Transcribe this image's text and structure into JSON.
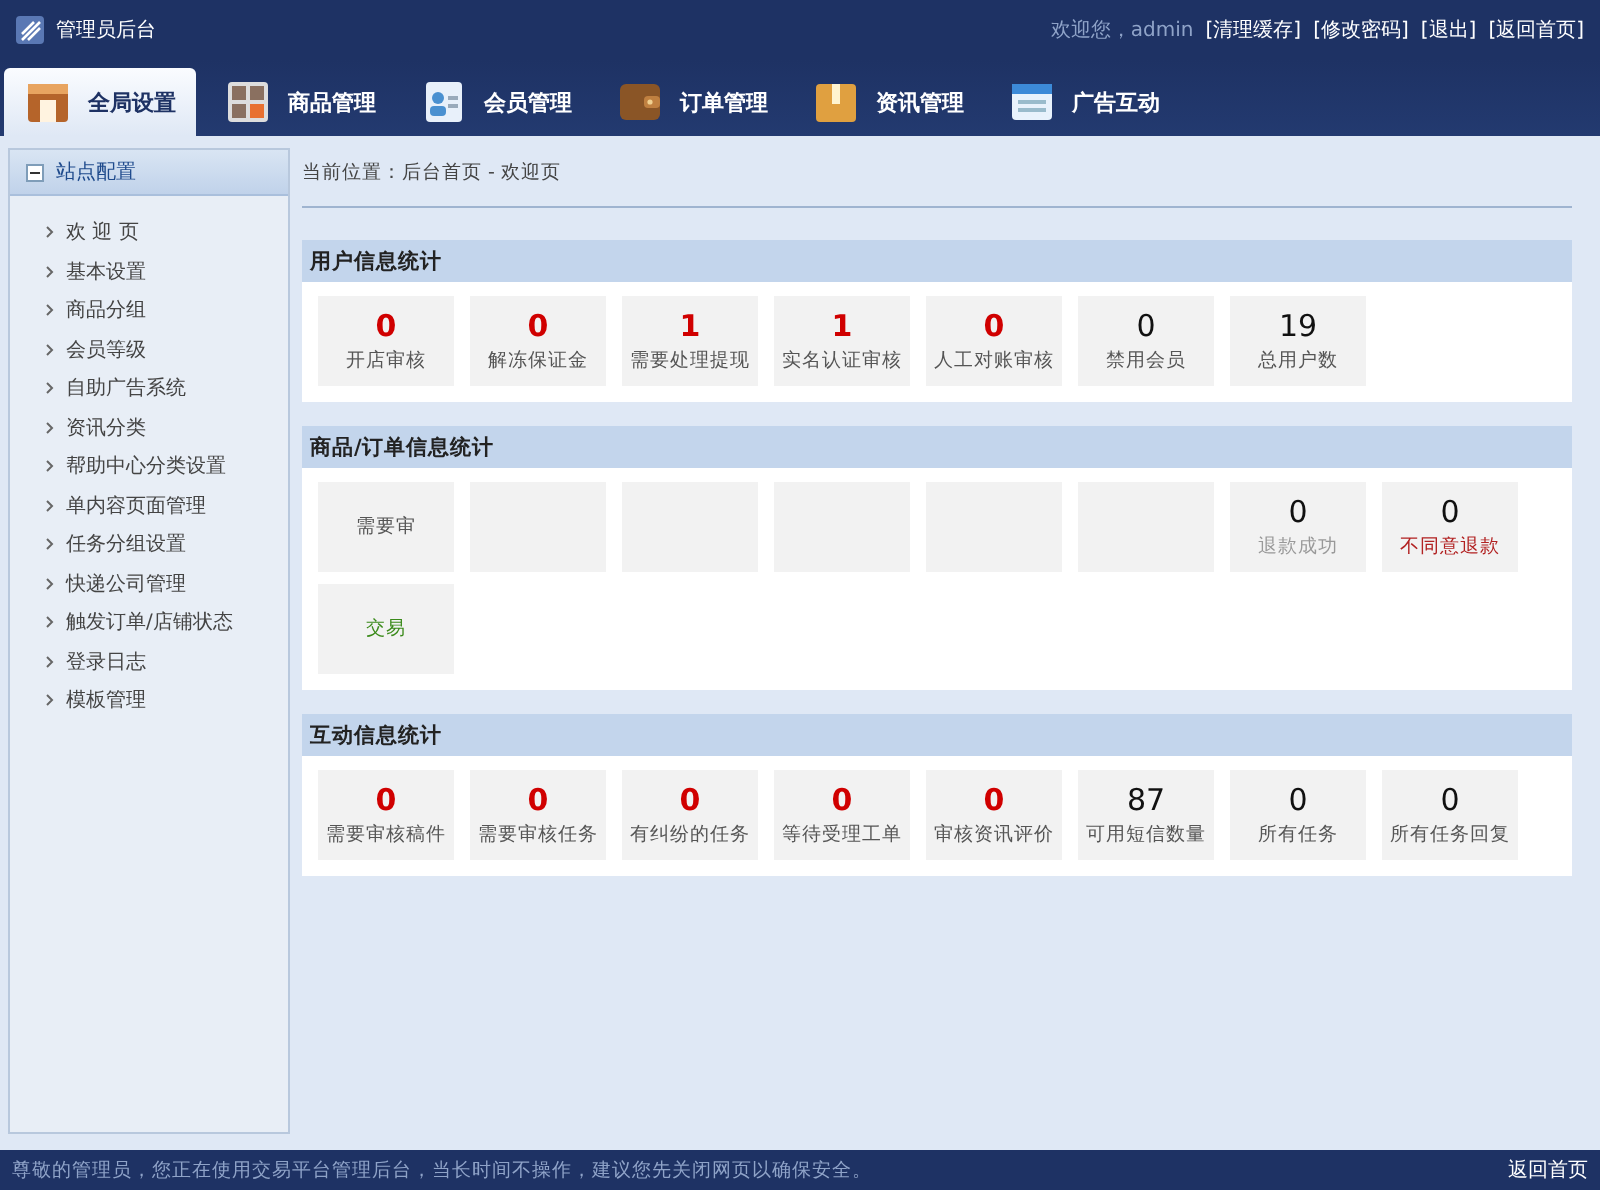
{
  "header": {
    "title": "管理员后台",
    "welcome": "欢迎您，admin",
    "links": [
      "[清理缓存]",
      "[修改密码]",
      "[退出]",
      "[返回首页]"
    ]
  },
  "tabs": [
    {
      "label": "全局设置",
      "selected": true
    },
    {
      "label": "商品管理",
      "selected": false
    },
    {
      "label": "会员管理",
      "selected": false
    },
    {
      "label": "订单管理",
      "selected": false
    },
    {
      "label": "资讯管理",
      "selected": false
    },
    {
      "label": "广告互动",
      "selected": false
    }
  ],
  "sidebar": {
    "title": "站点配置",
    "expanded": true,
    "items": [
      "欢 迎 页",
      "基本设置",
      "商品分组",
      "会员等级",
      "自助广告系统",
      "资讯分类",
      "帮助中心分类设置",
      "单内容页面管理",
      "任务分组设置",
      "快递公司管理",
      "触发订单/店铺状态",
      "登录日志",
      "模板管理"
    ]
  },
  "breadcrumb": "当前位置：后台首页 - 欢迎页",
  "sections": [
    {
      "title": "用户信息统计",
      "rows": [
        [
          {
            "kind": "stat",
            "value": "0",
            "label": "开店审核",
            "alert": true,
            "color": "#555555"
          },
          {
            "kind": "stat",
            "value": "0",
            "label": "解冻保证金",
            "alert": true,
            "color": "#555555"
          },
          {
            "kind": "stat",
            "value": "1",
            "label": "需要处理提现",
            "alert": true,
            "color": "#555555"
          },
          {
            "kind": "stat",
            "value": "1",
            "label": "实名认证审核",
            "alert": true,
            "color": "#555555"
          },
          {
            "kind": "stat",
            "value": "0",
            "label": "人工对账审核",
            "alert": true,
            "color": "#555555"
          },
          {
            "kind": "stat",
            "value": "0",
            "label": "禁用会员",
            "alert": false,
            "color": "#555555"
          },
          {
            "kind": "stat",
            "value": "19",
            "label": "总用户数",
            "alert": false,
            "color": "#555555"
          }
        ]
      ]
    },
    {
      "title": "商品/订单信息统计",
      "rows": [
        [
          {
            "kind": "stat",
            "label": "需要审",
            "color": "#555555"
          },
          {
            "kind": "blank"
          },
          {
            "kind": "blank"
          },
          {
            "kind": "blank"
          },
          {
            "kind": "blank"
          },
          {
            "kind": "blank"
          },
          {
            "kind": "stat",
            "value": "0",
            "label": "退款成功",
            "alert": false,
            "color": "#999999"
          },
          {
            "kind": "stat",
            "value": "0",
            "label": "不同意退款",
            "alert": false,
            "color": "#b22222"
          }
        ],
        [
          {
            "kind": "stat",
            "label": "交易",
            "color": "#3a8a1a"
          }
        ]
      ]
    },
    {
      "title": "互动信息统计",
      "rows": [
        [
          {
            "kind": "stat",
            "value": "0",
            "label": "需要审核稿件",
            "alert": true,
            "color": "#555555"
          },
          {
            "kind": "stat",
            "value": "0",
            "label": "需要审核任务",
            "alert": true,
            "color": "#555555"
          },
          {
            "kind": "stat",
            "value": "0",
            "label": "有纠纷的任务",
            "alert": true,
            "color": "#555555"
          },
          {
            "kind": "stat",
            "value": "0",
            "label": "等待受理工单",
            "alert": true,
            "color": "#555555"
          },
          {
            "kind": "stat",
            "value": "0",
            "label": "审核资讯评价",
            "alert": true,
            "color": "#555555"
          },
          {
            "kind": "stat",
            "value": "87",
            "label": "可用短信数量",
            "alert": false,
            "color": "#555555"
          },
          {
            "kind": "stat",
            "value": "0",
            "label": "所有任务",
            "alert": false,
            "color": "#555555"
          },
          {
            "kind": "stat",
            "value": "0",
            "label": "所有任务回复",
            "alert": false,
            "color": "#555555"
          }
        ]
      ]
    }
  ],
  "footer": {
    "notice": "尊敬的管理员，您正在使用交易平台管理后台，当长时间不操作，建议您先关闭网页以确保安全。",
    "link": "返回首页"
  }
}
